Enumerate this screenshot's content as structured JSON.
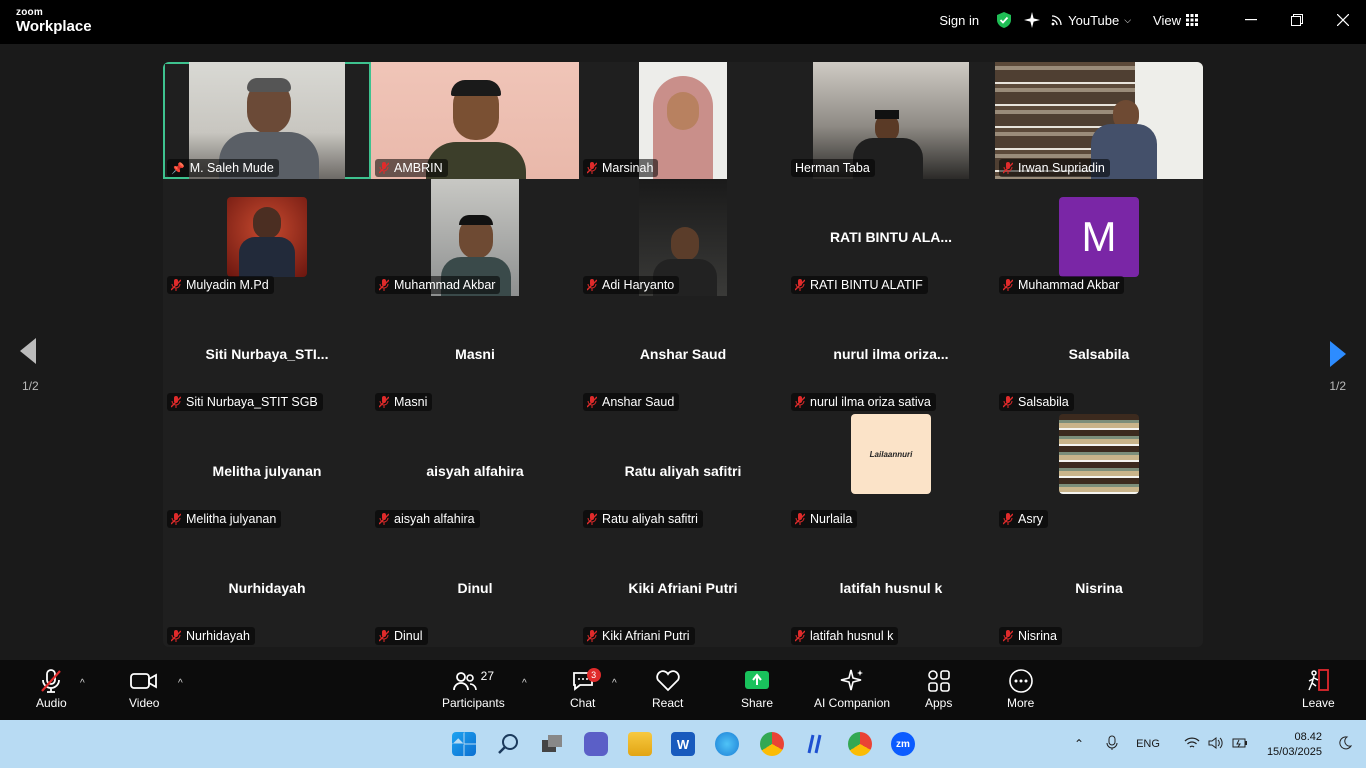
{
  "app": {
    "brand_small": "zoom",
    "brand_large": "Workplace"
  },
  "titlebar": {
    "signin": "Sign in",
    "youtube": "YouTube",
    "view": "View"
  },
  "pager": {
    "left": "1/2",
    "right": "1/2"
  },
  "tiles": [
    {
      "name": "M. Saleh Mude",
      "big": "",
      "active": true,
      "pinned": true
    },
    {
      "name": "AMBRIN",
      "big": ""
    },
    {
      "name": "Marsinah",
      "big": ""
    },
    {
      "name": "Herman Taba",
      "big": ""
    },
    {
      "name": "Irwan Supriadin",
      "big": ""
    },
    {
      "name": "Mulyadin M.Pd",
      "big": ""
    },
    {
      "name": "Muhammad Akbar",
      "big": ""
    },
    {
      "name": "Adi Haryanto",
      "big": ""
    },
    {
      "name": "RATI BINTU ALATIF",
      "big": "RATI BINTU ALA..."
    },
    {
      "name": "Muhammad Akbar",
      "big": "",
      "avatar_letter": "M"
    },
    {
      "name": "Siti Nurbaya_STIT SGB",
      "big": "Siti  Nurbaya_STI..."
    },
    {
      "name": "Masni",
      "big": "Masni"
    },
    {
      "name": "Anshar Saud",
      "big": "Anshar Saud"
    },
    {
      "name": "nurul ilma oriza sativa",
      "big": "nurul  ilma  oriza..."
    },
    {
      "name": "Salsabila",
      "big": "Salsabila"
    },
    {
      "name": "Melitha julyanan",
      "big": "Melitha julyanan"
    },
    {
      "name": "aisyah alfahira",
      "big": "aisyah alfahira"
    },
    {
      "name": "Ratu aliyah safitri",
      "big": "Ratu aliyah safitri"
    },
    {
      "name": "Nurlaila",
      "big": "",
      "avatar_text": "Lailaannuri"
    },
    {
      "name": "Asry",
      "big": ""
    },
    {
      "name": "Nurhidayah",
      "big": "Nurhidayah"
    },
    {
      "name": "Dinul",
      "big": "Dinul"
    },
    {
      "name": "Kiki Afriani Putri",
      "big": "Kiki Afriani Putri"
    },
    {
      "name": "latifah husnul k",
      "big": "latifah husnul k"
    },
    {
      "name": "Nisrina",
      "big": "Nisrina"
    }
  ],
  "toolbar": {
    "audio": "Audio",
    "video": "Video",
    "participants": "Participants",
    "participants_count": "27",
    "chat": "Chat",
    "chat_badge": "3",
    "react": "React",
    "share": "Share",
    "ai": "AI Companion",
    "apps": "Apps",
    "more": "More",
    "leave": "Leave"
  },
  "taskbar": {
    "lang": "ENG",
    "time": "08.42",
    "date": "15/03/2025"
  },
  "colors": {
    "active_border": "#3ec28f",
    "share_green": "#19c25c",
    "leave_red": "#e0282d",
    "avatar_purple": "#7a26a6"
  }
}
